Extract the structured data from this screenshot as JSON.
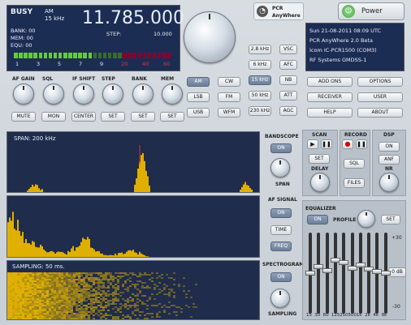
{
  "readout": {
    "busy": "BUSY",
    "mode": "AM",
    "bw": "15 kHz",
    "freq": "11.785.000",
    "bank": "BANK: 00",
    "mem": "MEM: 00",
    "equ": "EQU: 00",
    "step_label": "STEP:",
    "step_value": "10.000",
    "scale": [
      "1",
      "3",
      "5",
      "7",
      "9",
      "20",
      "40",
      "60"
    ],
    "signal_level": 0.5
  },
  "logo": {
    "line1": "PCR",
    "line2": "AnyWhere"
  },
  "power": {
    "label": "Power"
  },
  "info": {
    "lines": [
      "Sun 21-08-2011 08:09 UTC",
      "PCR AnyWhere 2.0 Beta",
      "Icom IC-PCR1500 (COM3)",
      "RF Systems GMDSS-1"
    ]
  },
  "knobs": [
    "AF GAIN",
    "SQL",
    "IF SHIFT",
    "STEP",
    "BANK",
    "MEM"
  ],
  "knob_buttons": [
    "MUTE",
    "MON",
    "CENTER",
    "SET",
    "SET",
    "SET"
  ],
  "step_buttons": [
    "2.8 kHz",
    "6 kHz",
    "15 kHz",
    "50 kHz",
    "230 kHz"
  ],
  "mode_buttons": [
    "AM",
    "CW",
    "LSB",
    "FM",
    "USB",
    "WFM"
  ],
  "vsc": [
    "VSC",
    "AFC",
    "NB",
    "ATT",
    "AGC"
  ],
  "right_buttons": [
    "ADD ONS",
    "OPTIONS",
    "RECEIVER",
    "USER",
    "HELP",
    "ABOUT"
  ],
  "bandscope": {
    "span_text": "SPAN: 200 kHz",
    "title": "BANDSCOPE",
    "on": "ON",
    "knob": "SPAN"
  },
  "afsignal": {
    "title": "AF SIGNAL",
    "on": "ON",
    "time": "TIME",
    "freq": "FREQ"
  },
  "spectrogram": {
    "sampling_text": "SAMPLING: 50 ms.",
    "title": "SPECTROGRAM",
    "on": "ON",
    "knob": "SAMPLING"
  },
  "scan": {
    "title": "SCAN",
    "set": "SET",
    "knob": "DELAY"
  },
  "record": {
    "title": "RECORD",
    "sql": "SQL",
    "files": "FILES"
  },
  "dsp": {
    "title": "DSP",
    "on": "ON",
    "anf": "ANF",
    "knob": "NR"
  },
  "equalizer": {
    "title": "EQUALIZER",
    "on": "ON",
    "profile": "PROFILE",
    "set": "SET",
    "db_btn": "0 dB",
    "plus": "+30",
    "minus": "-30",
    "bands": [
      "15",
      "30",
      "60",
      "125",
      "250",
      "500",
      "1k",
      "2k",
      "4k",
      "8k"
    ],
    "levels": [
      0,
      5,
      2,
      10,
      8,
      4,
      6,
      3,
      1,
      0
    ]
  }
}
